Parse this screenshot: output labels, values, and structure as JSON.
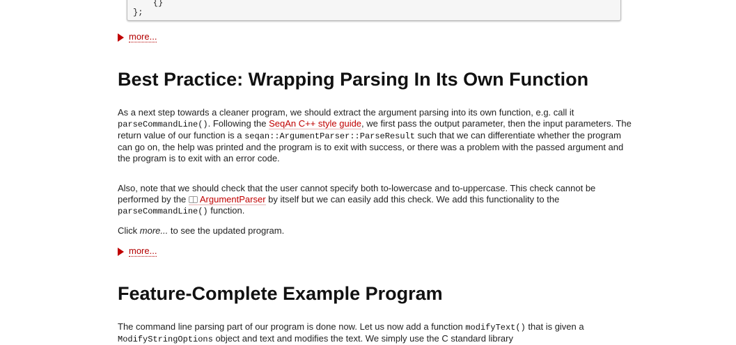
{
  "code_tail": {
    "line1": "    {}",
    "line2": "};"
  },
  "more_label": "more...",
  "section1": {
    "heading": "Best Practice: Wrapping Parsing In Its Own Function",
    "p1": {
      "t1": "As a next step towards a cleaner program, we should extract the argument parsing into its own function, e.g. call it ",
      "code1": "parseCommandLine()",
      "t2": ". Following the ",
      "link1": "SeqAn C++ style guide",
      "t3": ", we first pass the output parameter, then the input parameters. The return value of our function is a ",
      "code2": "seqan::ArgumentParser::ParseResult",
      "t4": " such that we can differentiate whether the program can go on, the help was printed and the program is to exit with success, or there was a problem with the passed argument and the program is to exit with an error code."
    },
    "p2": {
      "t1": "Also, note that we should check that the user cannot specify both to-lowercase and to-uppercase. This check cannot be performed by the ",
      "link1": "ArgumentParser",
      "t2": " by itself but we can easily add this check. We add this functionality to the ",
      "code1": "parseCommandLine()",
      "t3": " function."
    },
    "p3": {
      "t1": "Click ",
      "em": "more...",
      "t2": " to see the updated program."
    }
  },
  "section2": {
    "heading": "Feature-Complete Example Program",
    "p1": {
      "t1": "The command line parsing part of our program is done now. Let us now add a function ",
      "code1": "modifyText()",
      "t2": " that is given a ",
      "code2": "ModifyStringOptions",
      "t3": " object and text and modifies the text. We simply use the C standard library"
    }
  }
}
